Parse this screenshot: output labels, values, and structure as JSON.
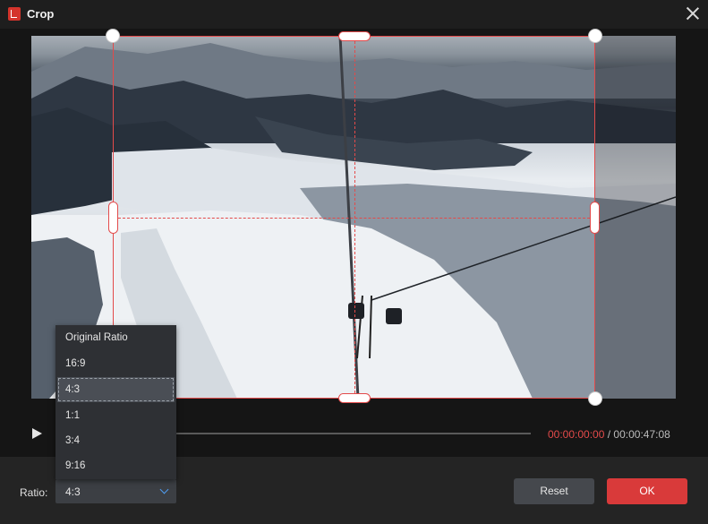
{
  "window": {
    "title": "Crop",
    "app_icon": "crop-app-icon",
    "close_icon": "close-icon"
  },
  "player": {
    "play_icon": "play-icon",
    "current_time": "00:00:00:00",
    "separator": " / ",
    "total_time": "00:00:47:08"
  },
  "ratio": {
    "label": "Ratio:",
    "selected": "4:3",
    "options": [
      "Original Ratio",
      "16:9",
      "4:3",
      "1:1",
      "3:4",
      "9:16"
    ],
    "dropdown_icon": "chevron-down-icon"
  },
  "buttons": {
    "reset": "Reset",
    "ok": "OK"
  },
  "colors": {
    "accent": "#d93a3a",
    "crop_frame": "#e34a4a",
    "chevron": "#4f9cf0"
  }
}
